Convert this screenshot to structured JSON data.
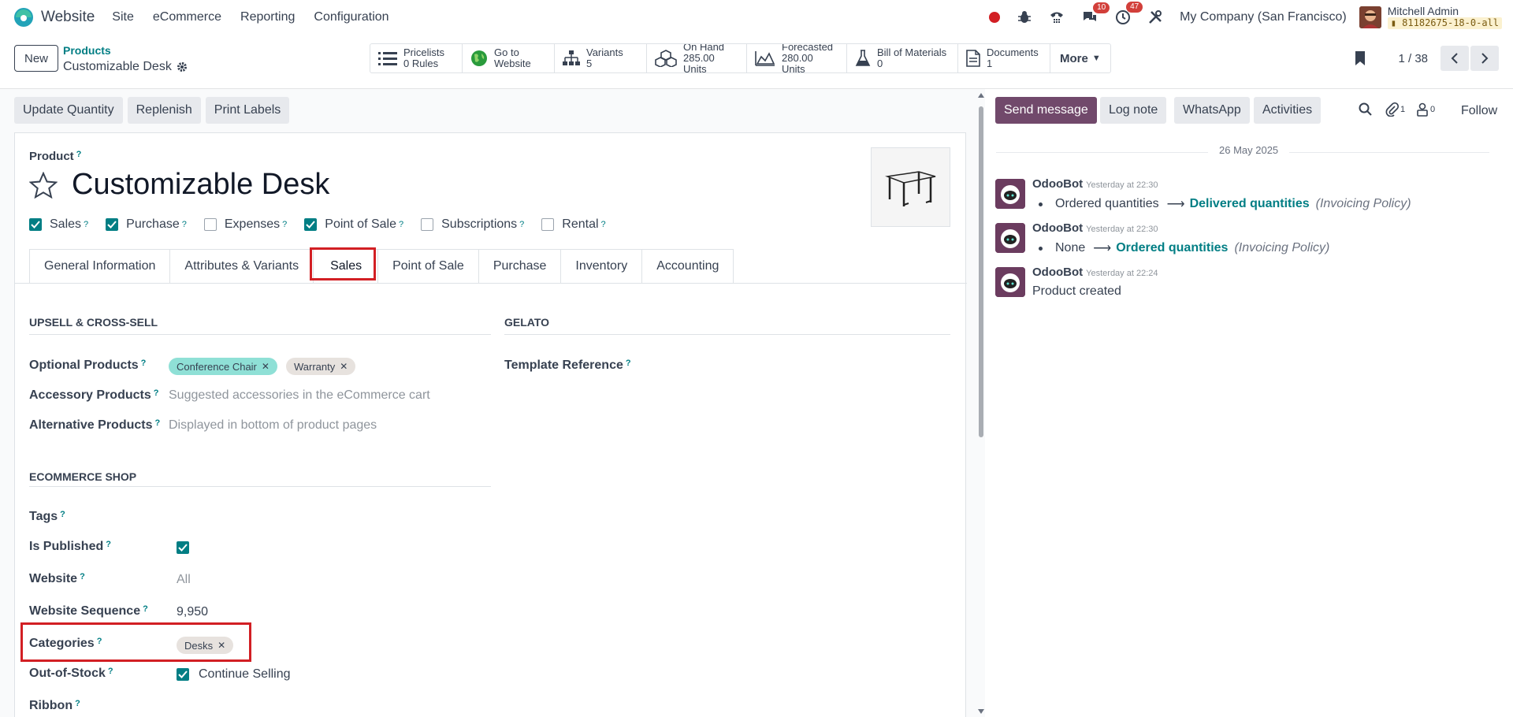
{
  "navbar": {
    "app_name": "Website",
    "menu": [
      "Site",
      "eCommerce",
      "Reporting",
      "Configuration"
    ],
    "badge_messages": "10",
    "badge_activities": "47",
    "company": "My Company (San Francisco)",
    "user_name": "Mitchell Admin",
    "db_name": "81182675-18-0-all"
  },
  "control_panel": {
    "new_label": "New",
    "breadcrumb_parent": "Products",
    "breadcrumb_current": "Customizable Desk",
    "smart_buttons": [
      {
        "line1": "Pricelists",
        "line2": "0 Rules"
      },
      {
        "line1": "Go to",
        "line2": "Website"
      },
      {
        "line1": "Variants",
        "line2": "5"
      },
      {
        "line1": "On Hand",
        "line2": "285.00 Units"
      },
      {
        "line1": "Forecasted",
        "line2": "280.00 Units"
      },
      {
        "line1": "Bill of Materials",
        "line2": "0"
      },
      {
        "line1": "Documents",
        "line2": "1"
      }
    ],
    "more_label": "More",
    "pager": "1 / 38"
  },
  "actions": [
    "Update Quantity",
    "Replenish",
    "Print Labels"
  ],
  "form": {
    "product_label": "Product",
    "help_mark": "?",
    "title": "Customizable Desk",
    "checkboxes": [
      {
        "label": "Sales",
        "checked": true
      },
      {
        "label": "Purchase",
        "checked": true
      },
      {
        "label": "Expenses",
        "checked": false
      },
      {
        "label": "Point of Sale",
        "checked": true
      },
      {
        "label": "Subscriptions",
        "checked": false
      },
      {
        "label": "Rental",
        "checked": false
      }
    ],
    "tabs": [
      "General Information",
      "Attributes & Variants",
      "Sales",
      "Point of Sale",
      "Purchase",
      "Inventory",
      "Accounting"
    ],
    "active_tab": "Sales",
    "upsell": {
      "title": "UPSELL & CROSS-SELL",
      "optional_label": "Optional Products",
      "optional_tags": [
        "Conference Chair",
        "Warranty"
      ],
      "accessory_label": "Accessory Products",
      "accessory_placeholder": "Suggested accessories in the eCommerce cart",
      "alternative_label": "Alternative Products",
      "alternative_placeholder": "Displayed in bottom of product pages"
    },
    "gelato": {
      "title": "GELATO",
      "template_label": "Template Reference"
    },
    "shop": {
      "title": "ECOMMERCE SHOP",
      "tags_label": "Tags",
      "published_label": "Is Published",
      "website_label": "Website",
      "website_value": "All",
      "sequence_label": "Website Sequence",
      "sequence_value": "9,950",
      "categories_label": "Categories",
      "category_tag": "Desks",
      "oos_label": "Out-of-Stock",
      "oos_value": "Continue Selling",
      "ribbon_label": "Ribbon"
    }
  },
  "chatter": {
    "send_label": "Send message",
    "log_label": "Log note",
    "whatsapp_label": "WhatsApp",
    "activities_label": "Activities",
    "attach_count": "1",
    "follower_count": "0",
    "follow_label": "Follow",
    "date": "26 May 2025",
    "messages": [
      {
        "author": "OdooBot",
        "time": "Yesterday at 22:30",
        "old": "Ordered quantities",
        "new": "Delivered quantities",
        "field": "(Invoicing Policy)"
      },
      {
        "author": "OdooBot",
        "time": "Yesterday at 22:30",
        "old": "None",
        "new": "Ordered quantities",
        "field": "(Invoicing Policy)"
      },
      {
        "author": "OdooBot",
        "time": "Yesterday at 22:24",
        "body": "Product created"
      }
    ]
  },
  "colors": {
    "accent": "#017e84",
    "primary": "#71496b",
    "highlight": "#d21f24"
  }
}
